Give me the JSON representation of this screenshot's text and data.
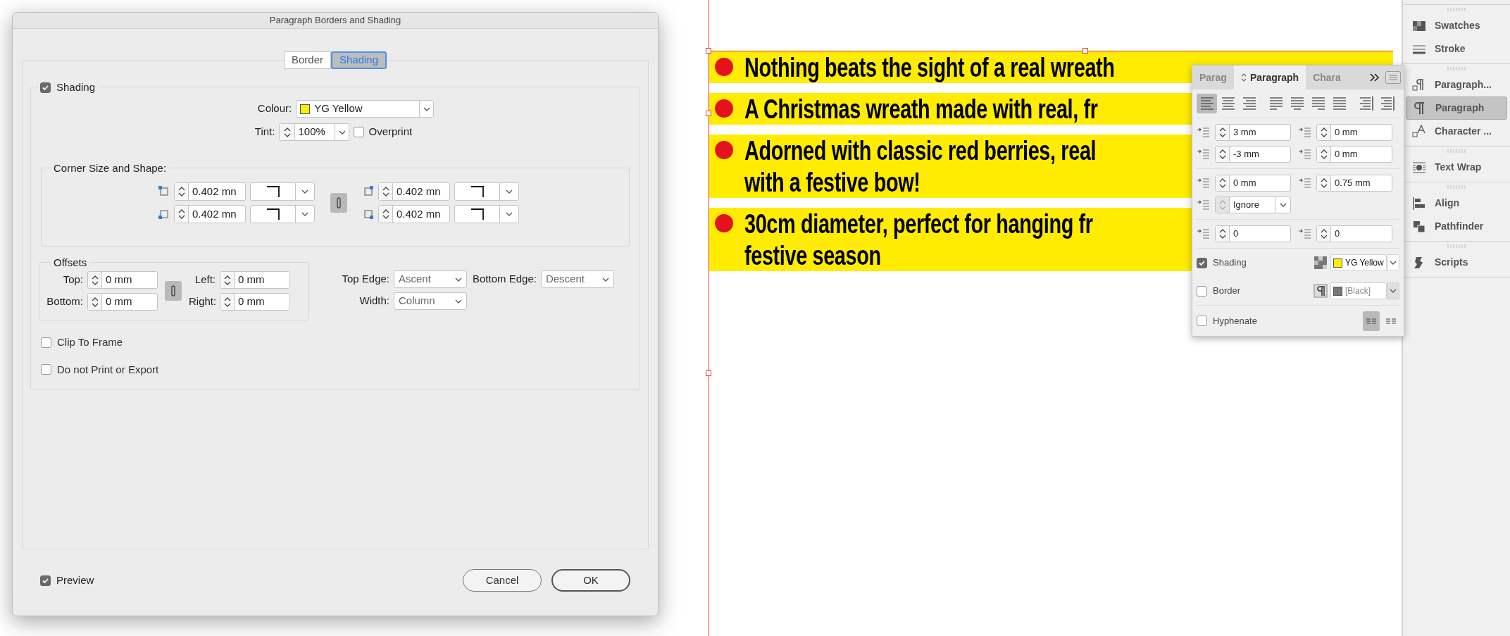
{
  "dialog": {
    "title": "Paragraph Borders and Shading",
    "tabs": [
      {
        "label": "Border",
        "selected": false
      },
      {
        "label": "Shading",
        "selected": true
      }
    ],
    "shading": {
      "label": "Shading",
      "checked": true
    },
    "colour": {
      "label": "Colour:",
      "value": "YG Yellow",
      "color": "#ffee00"
    },
    "tint": {
      "label": "Tint:",
      "value": "100%"
    },
    "overprint": {
      "label": "Overprint",
      "checked": false
    },
    "corner": {
      "title": "Corner Size and Shape:",
      "corners": [
        {
          "value": "0.402 mn"
        },
        {
          "value": "0.402 mn"
        },
        {
          "value": "0.402 mn"
        },
        {
          "value": "0.402 mn"
        }
      ]
    },
    "offsets": {
      "title": "Offsets",
      "fields": [
        {
          "label": "Top:",
          "value": "0 mm"
        },
        {
          "label": "Left:",
          "value": "0 mm"
        },
        {
          "label": "Bottom:",
          "value": "0 mm"
        },
        {
          "label": "Right:",
          "value": "0 mm"
        }
      ]
    },
    "edges": [
      {
        "label": "Top Edge:",
        "value": "Ascent"
      },
      {
        "label": "Bottom Edge:",
        "value": "Descent"
      },
      {
        "label": "Width:",
        "value": "Column"
      }
    ],
    "options": [
      {
        "label": "Clip To Frame",
        "checked": false
      },
      {
        "label": "Do not Print or Export",
        "checked": false
      }
    ],
    "preview": {
      "label": "Preview",
      "checked": true
    },
    "buttons": [
      {
        "label": "Cancel"
      },
      {
        "label": "OK"
      }
    ]
  },
  "document": {
    "paragraphs": [
      {
        "lines": [
          "Nothing beats the sight of a real wreath"
        ]
      },
      {
        "lines": [
          "A Christmas wreath made with real, fr"
        ]
      },
      {
        "lines": [
          "Adorned with classic red berries, real",
          "with a festive bow!"
        ]
      },
      {
        "lines": [
          "30cm diameter, perfect for hanging fr",
          "festive season"
        ]
      }
    ]
  },
  "paragraph_panel": {
    "tabs": [
      {
        "label": "Parag",
        "selected": false
      },
      {
        "label": "Paragraph",
        "selected": true
      },
      {
        "label": "Chara",
        "selected": false
      }
    ],
    "alignments": [
      {
        "selected": true
      },
      {
        "selected": false
      },
      {
        "selected": false
      },
      {
        "selected": false
      },
      {
        "selected": false
      },
      {
        "selected": false
      },
      {
        "selected": false
      },
      {
        "selected": false
      },
      {
        "selected": false
      }
    ],
    "field_groups": [
      {
        "rows": [
          [
            {
              "kind": "spin",
              "value": "3 mm"
            },
            {
              "kind": "spin",
              "value": "0 mm"
            }
          ],
          [
            {
              "kind": "spin",
              "value": "-3 mm"
            },
            {
              "kind": "spin",
              "value": "0 mm"
            }
          ]
        ]
      },
      {
        "rows": [
          [
            {
              "kind": "spin",
              "value": "0 mm"
            },
            {
              "kind": "spin",
              "value": "0.75 mm"
            }
          ],
          [
            {
              "kind": "select",
              "value": "Ignore"
            }
          ]
        ]
      },
      {
        "rows": [
          [
            {
              "kind": "spin",
              "value": "0"
            },
            {
              "kind": "spin",
              "value": "0"
            }
          ]
        ]
      }
    ],
    "shading": {
      "label": "Shading",
      "checked": true,
      "value": "YG Yellow",
      "color": "#ffee00"
    },
    "border": {
      "label": "Border",
      "checked": false,
      "value": "[Black]",
      "color": "#777777"
    },
    "hyphenate": {
      "label": "Hyphenate",
      "checked": false
    },
    "composers": [
      {
        "selected": true
      },
      {
        "selected": false
      }
    ]
  },
  "sidebar": {
    "groups": [
      {
        "items": [
          {
            "label": "Swatches",
            "selected": false
          },
          {
            "label": "Stroke",
            "selected": false
          }
        ]
      },
      {
        "items": [
          {
            "label": "Paragraph...",
            "selected": false
          },
          {
            "label": "Paragraph",
            "selected": true
          },
          {
            "label": "Character ...",
            "selected": false
          }
        ]
      },
      {
        "items": [
          {
            "label": "Text Wrap",
            "selected": false
          }
        ]
      },
      {
        "items": [
          {
            "label": "Align",
            "selected": false
          },
          {
            "label": "Pathfinder",
            "selected": false
          }
        ]
      },
      {
        "items": [
          {
            "label": "Scripts",
            "selected": false
          }
        ]
      }
    ]
  }
}
